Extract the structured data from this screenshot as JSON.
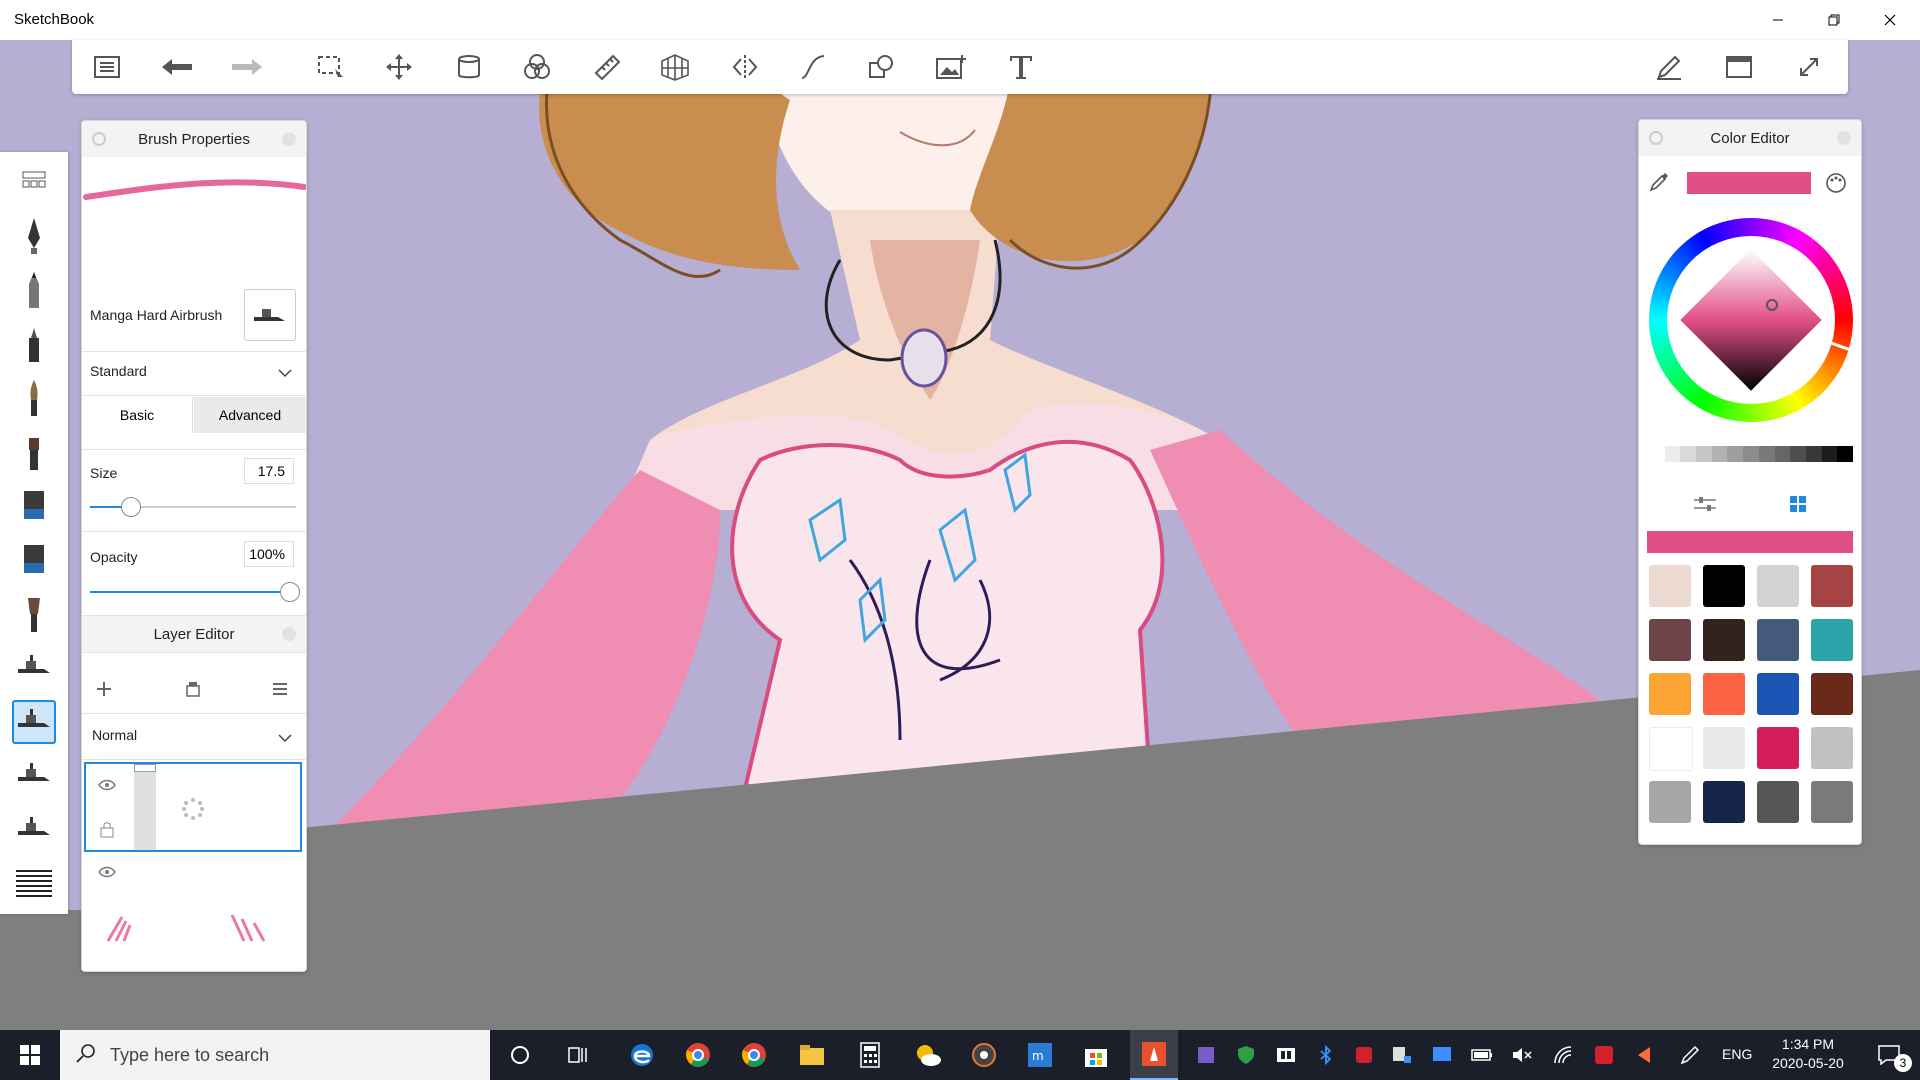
{
  "app": {
    "title": "SketchBook"
  },
  "brush_properties": {
    "title": "Brush Properties",
    "brush_name": "Manga Hard Airbrush",
    "preset": "Standard",
    "tabs": [
      "Basic",
      "Advanced"
    ],
    "active_tab": "Basic",
    "size_label": "Size",
    "size_value": "17.5",
    "size_fraction": 0.2,
    "opacity_label": "Opacity",
    "opacity_value": "100%",
    "opacity_fraction": 1.0
  },
  "layer_editor": {
    "title": "Layer Editor",
    "blend_mode": "Normal"
  },
  "color_editor": {
    "title": "Color Editor",
    "current_color": "#e24f87",
    "swatches": [
      "#ecd9d1",
      "#000000",
      "#d3d3d3",
      "#a84344",
      "#6d4448",
      "#33221e",
      "#445a7a",
      "#2aa4a8",
      "#faa533",
      "#fc6343",
      "#1d55b5",
      "#6a2a1a",
      "#ffffff",
      "#e8e8e8",
      "#d41d5c",
      "#c1c1c1",
      "#a6a6a6",
      "#15254a",
      "#565656",
      "#7a7a7a"
    ],
    "grays": [
      "#ffffff",
      "#ececec",
      "#d9d9d9",
      "#c6c6c6",
      "#b2b2b2",
      "#9f9f9f",
      "#8c8c8c",
      "#797979",
      "#666666",
      "#4f4f4f",
      "#383838",
      "#1c1c1c",
      "#000000"
    ]
  },
  "taskbar": {
    "search_placeholder": "Type here to search",
    "language": "ENG",
    "time": "1:34 PM",
    "date": "2020-05-20",
    "notification_count": "3"
  },
  "colors": {
    "accent": "#1e88e5",
    "canvas_bg": "#b6afd3",
    "dress_pink": "#ee7faa",
    "workspace_gray": "#7f7f7f"
  }
}
